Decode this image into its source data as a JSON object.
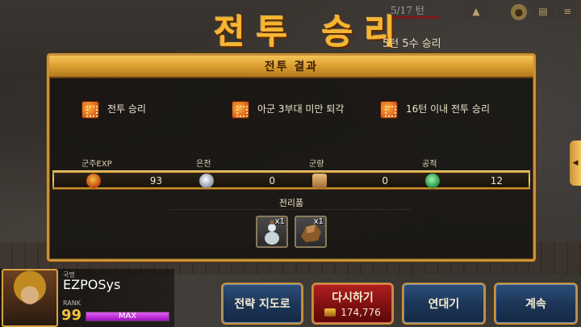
{
  "hud": {
    "turn_label": "5/17 턴",
    "icons": [
      "hat-icon",
      "coin-icon",
      "scroll-icon",
      "menu-icon"
    ]
  },
  "title": "전투 승리",
  "subtitle": "5턴 5수 승리",
  "panel": {
    "header": "전투 결과",
    "objectives": [
      {
        "icon": "stamp-icon",
        "text": "전투 승리"
      },
      {
        "icon": "stamp-icon",
        "text": "아군 3부대 미만 퇴각"
      },
      {
        "icon": "stamp-icon",
        "text": "16턴 이내 전투 승리"
      }
    ],
    "resources": [
      {
        "label": "군주EXP",
        "icon": "helmet-icon",
        "value": "93"
      },
      {
        "label": "은전",
        "icon": "silver-coin-icon",
        "value": "0"
      },
      {
        "label": "군량",
        "icon": "grain-sack-icon",
        "value": "0"
      },
      {
        "label": "공적",
        "icon": "jade-icon",
        "value": "12"
      }
    ],
    "loot_title": "전리품",
    "loot": [
      {
        "icon": "gourd-icon",
        "count": "x1"
      },
      {
        "icon": "ore-icon",
        "count": "x1"
      }
    ]
  },
  "player": {
    "nation_label": "국명",
    "name": "EZPOSys",
    "rank_label": "RANK",
    "rank": "99",
    "exp_text": "MAX",
    "exp_fraction": 1.0
  },
  "buttons": {
    "strategy_map": "전략 지도로",
    "retry": "다시하기",
    "retry_cost": "174,776",
    "continue_battle": "연대기",
    "next": "계속"
  },
  "colors": {
    "title_gold": "#f6b632",
    "panel_border": "#c9923a",
    "button_blue": "#1d3658",
    "button_red": "#801010",
    "exp_purple": "#a010c0"
  }
}
